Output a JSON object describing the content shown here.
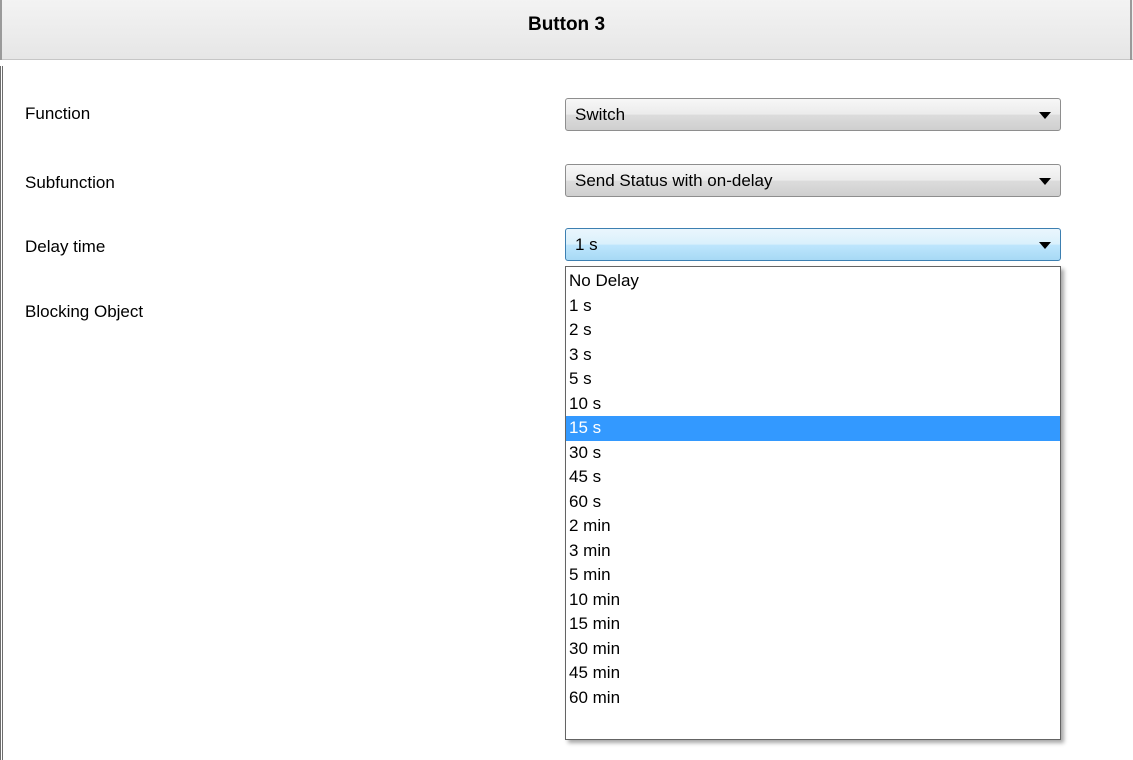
{
  "header": {
    "title": "Button 3"
  },
  "form": {
    "function": {
      "label": "Function",
      "value": "Switch"
    },
    "subfunction": {
      "label": "Subfunction",
      "value": "Send Status with on-delay"
    },
    "delay_time": {
      "label": "Delay time",
      "value": "1 s"
    },
    "blocking_object": {
      "label": "Blocking Object"
    }
  },
  "dropdown": {
    "highlighted": "15 s",
    "options": [
      "No Delay",
      "1 s",
      "2 s",
      "3 s",
      "5 s",
      "10 s",
      "15 s",
      "30 s",
      "45 s",
      "60 s",
      "2 min",
      "3 min",
      "5 min",
      "10 min",
      "15 min",
      "30 min",
      "45 min",
      "60 min"
    ]
  },
  "colors": {
    "highlight": "#3399ff",
    "active_border": "#3c7fb1"
  },
  "icons": {
    "combo_arrow": "triangle-down-icon"
  }
}
